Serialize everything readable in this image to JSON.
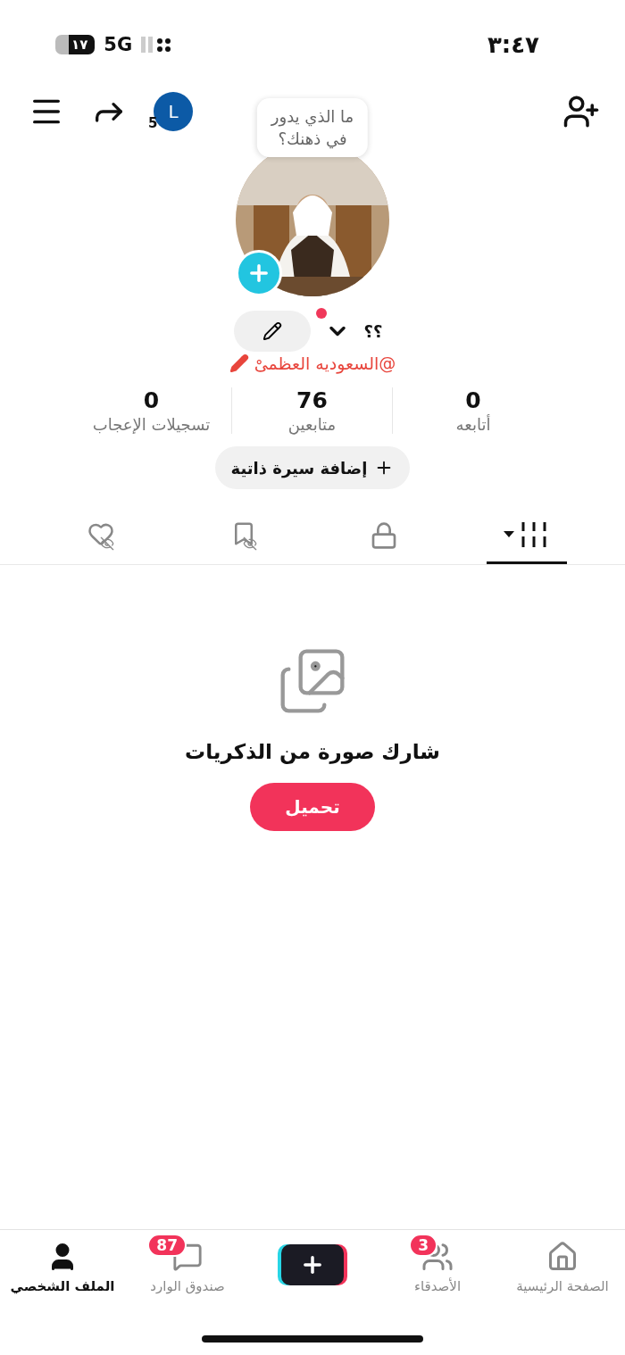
{
  "status_bar": {
    "time": "٣:٤٧",
    "network": "5G",
    "battery": "١٧"
  },
  "header": {
    "account_letter": "L",
    "account_count": "5"
  },
  "profile": {
    "avatar": {
      "kind": "picture"
    },
    "thought_bubble": [
      "ما الذي يدور",
      "في ذهنك؟"
    ],
    "name": "؟؟",
    "has_notification": true,
    "username": "@السعوديه العظمىْ"
  },
  "stats": [
    {
      "value": "0",
      "label": "أتابعه"
    },
    {
      "value": "76",
      "label": "متابعين"
    },
    {
      "value": "0",
      "label": "تسجيلات الإعجاب"
    }
  ],
  "bio_button": "إضافة سيرة ذاتية",
  "tabs": [
    {
      "kind": "videos",
      "selected": true
    },
    {
      "kind": "private",
      "selected": false
    },
    {
      "kind": "favorites",
      "selected": false
    },
    {
      "kind": "liked",
      "selected": false
    }
  ],
  "empty_state": {
    "message": "شارك صورة من الذكريات",
    "button": "تحميل"
  },
  "bottom_nav": [
    {
      "kind": "home",
      "label": "الصفحة الرئيسية",
      "selected": false
    },
    {
      "kind": "friends",
      "label": "الأصدقاء",
      "badge": "3",
      "selected": false
    },
    {
      "kind": "create"
    },
    {
      "kind": "inbox",
      "label": "صندوق الوارد",
      "badge": "87",
      "selected": false
    },
    {
      "kind": "profile",
      "label": "الملف الشخصي",
      "selected": true
    }
  ]
}
